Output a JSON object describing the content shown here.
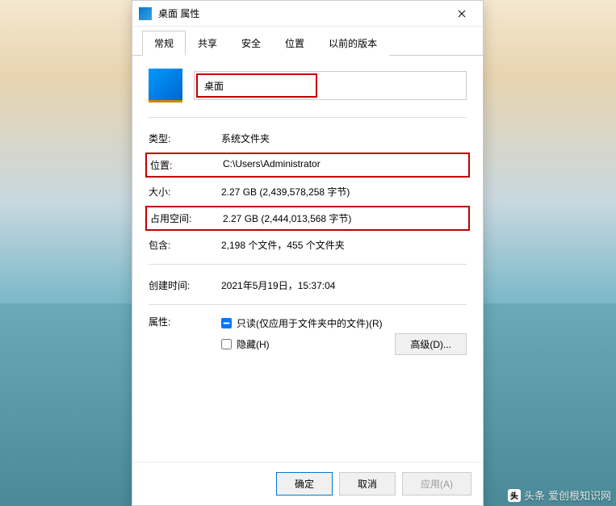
{
  "window": {
    "title": "桌面 属性"
  },
  "tabs": {
    "general": "常规",
    "sharing": "共享",
    "security": "安全",
    "location": "位置",
    "previous": "以前的版本"
  },
  "nameField": {
    "value": "桌面"
  },
  "props": {
    "typeLabel": "类型:",
    "typeValue": "系统文件夹",
    "locationLabel": "位置:",
    "locationValue": "C:\\Users\\Administrator",
    "sizeLabel": "大小:",
    "sizeValue": "2.27 GB (2,439,578,258 字节)",
    "sizeOnDiskLabel": "占用空间:",
    "sizeOnDiskValue": "2.27 GB (2,444,013,568 字节)",
    "containsLabel": "包含:",
    "containsValue": "2,198 个文件，455 个文件夹",
    "createdLabel": "创建时间:",
    "createdValue": "2021年5月19日，15:37:04",
    "attrLabel": "属性:",
    "readonlyLabel": "只读(仅应用于文件夹中的文件)(R)",
    "hiddenLabel": "隐藏(H)",
    "advancedLabel": "高级(D)..."
  },
  "footer": {
    "ok": "确定",
    "cancel": "取消",
    "apply": "应用(A)"
  },
  "watermark": {
    "source": "头条",
    "brand": "爱创根知识网"
  }
}
